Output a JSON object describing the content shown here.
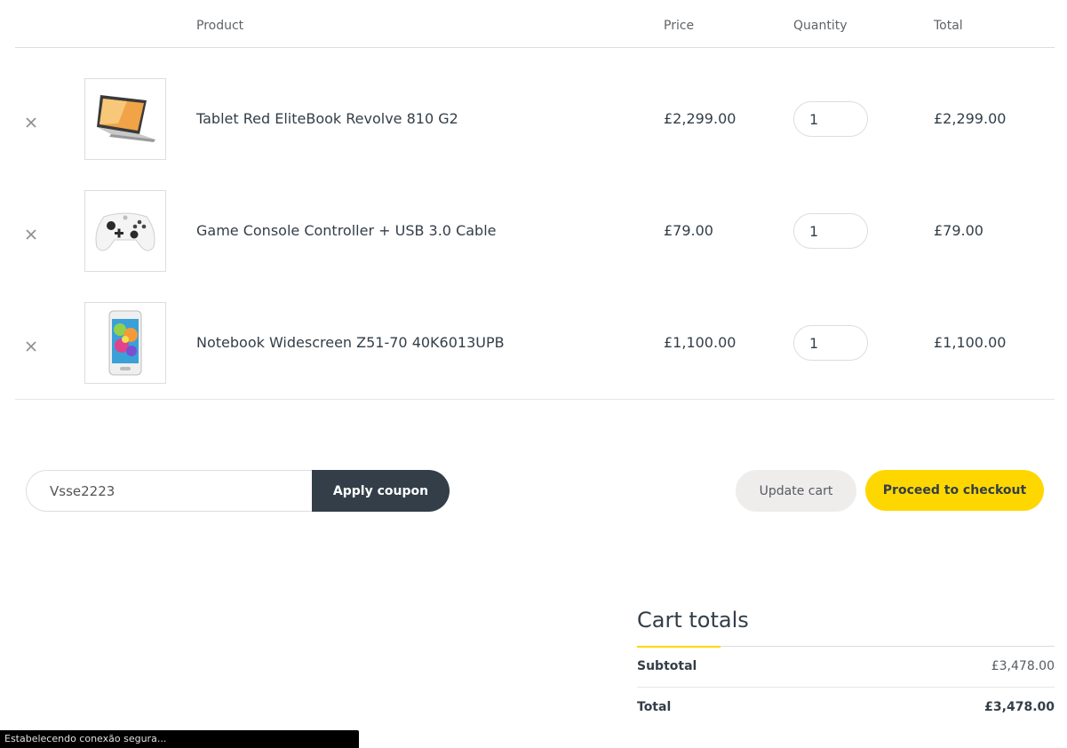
{
  "table": {
    "headers": {
      "product": "Product",
      "price": "Price",
      "quantity": "Quantity",
      "total": "Total"
    },
    "items": [
      {
        "name": "Tablet Red EliteBook Revolve 810 G2",
        "price": "£2,299.00",
        "quantity": "1",
        "total": "£2,299.00",
        "image_icon": "laptop-icon"
      },
      {
        "name": "Game Console Controller + USB 3.0 Cable",
        "price": "£79.00",
        "quantity": "1",
        "total": "£79.00",
        "image_icon": "gamepad-icon"
      },
      {
        "name": "Notebook Widescreen Z51-70 40K6013UPB",
        "price": "£1,100.00",
        "quantity": "1",
        "total": "£1,100.00",
        "image_icon": "smartphone-icon"
      }
    ],
    "remove_icon": "close-icon"
  },
  "actions": {
    "coupon_value": "Vsse2223",
    "apply_coupon_label": "Apply coupon",
    "update_cart_label": "Update cart",
    "checkout_label": "Proceed to checkout"
  },
  "totals": {
    "title": "Cart totals",
    "subtotal_label": "Subtotal",
    "subtotal_value": "£3,478.00",
    "total_label": "Total",
    "total_value": "£3,478.00"
  },
  "status_bar": {
    "text": "Estabelecendo conexão segura..."
  },
  "colors": {
    "accent": "#fed700",
    "dark_button": "#333e48",
    "light_button": "#efecec"
  }
}
